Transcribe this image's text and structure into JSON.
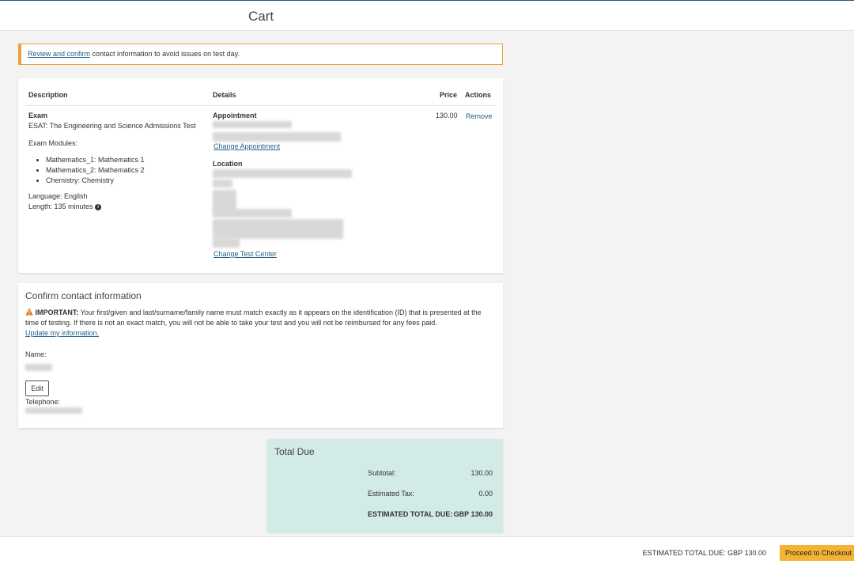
{
  "header": {
    "title": "Cart"
  },
  "banner": {
    "link_text": "Review and confirm",
    "text": " contact information to avoid issues on test day."
  },
  "cart": {
    "columns": {
      "description": "Description",
      "details": "Details",
      "price": "Price",
      "actions": "Actions"
    },
    "item": {
      "type": "Exam",
      "name": "ESAT: The Engineering and Science Admissions Test",
      "modules_label": "Exam Modules:",
      "modules": [
        "Mathematics_1: Mathematics 1",
        "Mathematics_2: Mathematics 2",
        "Chemistry: Chemistry"
      ],
      "language": "Language: English",
      "length": "Length: 135 minutes",
      "appointment_label": "Appointment",
      "change_appointment": "Change Appointment",
      "location_label": "Location",
      "change_test_center": "Change Test Center",
      "price": "130.00",
      "remove": "Remove"
    }
  },
  "contact": {
    "title": "Confirm contact information",
    "important_label": "IMPORTANT:",
    "important_text": " Your first/given and last/surname/family name must match exactly as it appears on the identification (ID) that is presented at the time of testing. If there is not an exact match, you will not be able to take your test and you will not be reimbursed for any fees paid.",
    "update_link": "Update my information.",
    "name_label": "Name:",
    "edit_button": "Edit",
    "telephone_label": "Telephone:"
  },
  "totals": {
    "title": "Total Due",
    "subtotal_label": "Subtotal:",
    "subtotal_value": "130.00",
    "tax_label": "Estimated Tax:",
    "tax_value": "0.00",
    "total_label": "ESTIMATED TOTAL DUE:",
    "total_value": "GBP 130.00"
  },
  "footer": {
    "total_text": "ESTIMATED TOTAL DUE: GBP 130.00",
    "checkout_button": "Proceed to Checkout"
  },
  "colors": {
    "accent_link": "#1d5f8b",
    "warning_border": "#e9a23b",
    "total_bg": "#d2ebe6",
    "checkout_button": "#f5b335"
  },
  "icons": [
    "info-icon",
    "warning-icon"
  ]
}
